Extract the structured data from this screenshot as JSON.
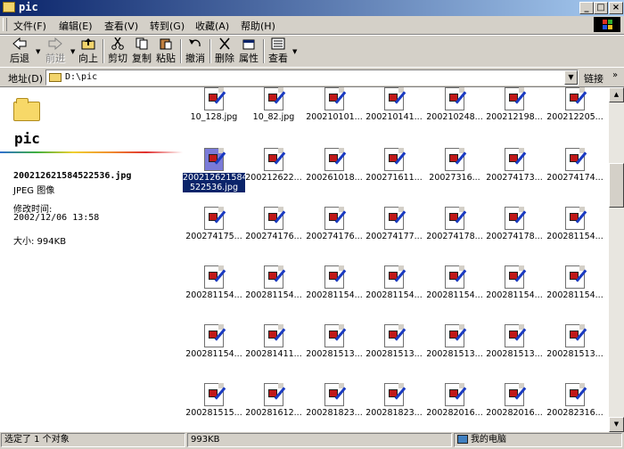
{
  "window": {
    "title": "pic"
  },
  "menu": [
    "文件(F)",
    "编辑(E)",
    "查看(V)",
    "转到(G)",
    "收藏(A)",
    "帮助(H)"
  ],
  "toolbar": {
    "back": "后退",
    "forward": "前进",
    "up": "向上",
    "cut": "剪切",
    "copy": "复制",
    "paste": "粘贴",
    "undo": "撤消",
    "delete": "删除",
    "properties": "属性",
    "view": "查看"
  },
  "address": {
    "label": "地址(D)",
    "value": "D:\\pic",
    "links": "链接"
  },
  "left_panel": {
    "folder_name": "pic",
    "file_name": "200212621584522536.jpg",
    "file_type": "JPEG 图像",
    "modified_label": "修改时间:",
    "modified_value": "2002/12/06 13:58",
    "size_label": "大小: 994KB"
  },
  "files": [
    "10_128.jpg",
    "10_82.jpg",
    "200210101...",
    "200210141...",
    "200210248...",
    "200212198...",
    "200212205...",
    "200212621584522536.jpg",
    "200212622...",
    "200261018...",
    "200271611...",
    "20027316...",
    "200274173...",
    "200274174...",
    "200274175...",
    "200274176...",
    "200274176...",
    "200274177...",
    "200274178...",
    "200274178...",
    "200281154...",
    "200281154...",
    "200281154...",
    "200281154...",
    "200281154...",
    "200281154...",
    "200281154...",
    "200281154...",
    "200281154...",
    "200281411...",
    "200281513...",
    "200281513...",
    "200281513...",
    "200281513...",
    "200281513...",
    "200281515...",
    "200281612...",
    "200281823...",
    "200281823...",
    "200282016...",
    "200282016...",
    "200282316..."
  ],
  "selected_index": 7,
  "selected_name_lines": [
    "200212621584",
    "522536.jpg"
  ],
  "status": {
    "selection": "选定了 1 个对象",
    "size": "993KB",
    "location": "我的电脑"
  }
}
